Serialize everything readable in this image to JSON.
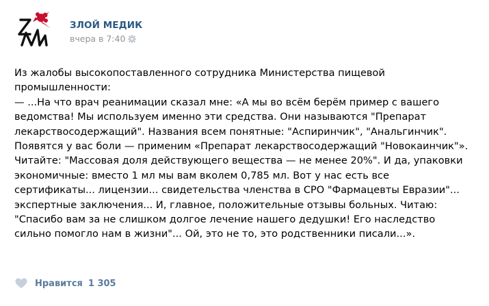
{
  "post": {
    "author": "ЗЛОЙ МЕДИК",
    "time": "вчера в 7:40",
    "avatar_icon": "zm-logo-icon",
    "settings_icon": "gear-icon",
    "body_lines": [
      "Из жалобы высокопоставленного сотрудника Министерства пищевой",
      "промышленности:",
      "— ...На что врач реанимации сказал мне: «А мы во всём берём пример с вашего",
      "ведомства! Мы используем именно эти средства. Они называются \"Препарат",
      "лекарствосодержащий\". Названия всем понятные: \"Аспиринчик\", \"Анальгинчик\".",
      "Появятся у вас боли — применим «Препарат лекарствосодержащий \"Новокаинчик\"».",
      "Читайте: \"Массовая доля действующего вещества — не менее 20%\". И да, упаковки",
      "экономичные: вместо 1 мл мы вам вколем 0,785 мл. Вот у нас есть все",
      "сертификаты... лицензии... свидетельства членства в СРО \"Фармацевты Евразии\"...",
      "экспертные заключения... И, главное, положительные отзывы больных. Читаю:",
      "\"Спасибо вам за не слишком долгое лечение нашего дедушки! Его наследство",
      "сильно помогло нам в жизни\"... Ой, это не то, это родственники писали...»."
    ],
    "like_label": "Нравится",
    "like_count": "1 305",
    "like_icon": "heart-icon"
  },
  "colors": {
    "author_link": "#2a5885",
    "meta_gray": "#939393",
    "like_blue": "#5b7b9c",
    "logo_red": "#c8102e",
    "logo_black": "#111111"
  }
}
